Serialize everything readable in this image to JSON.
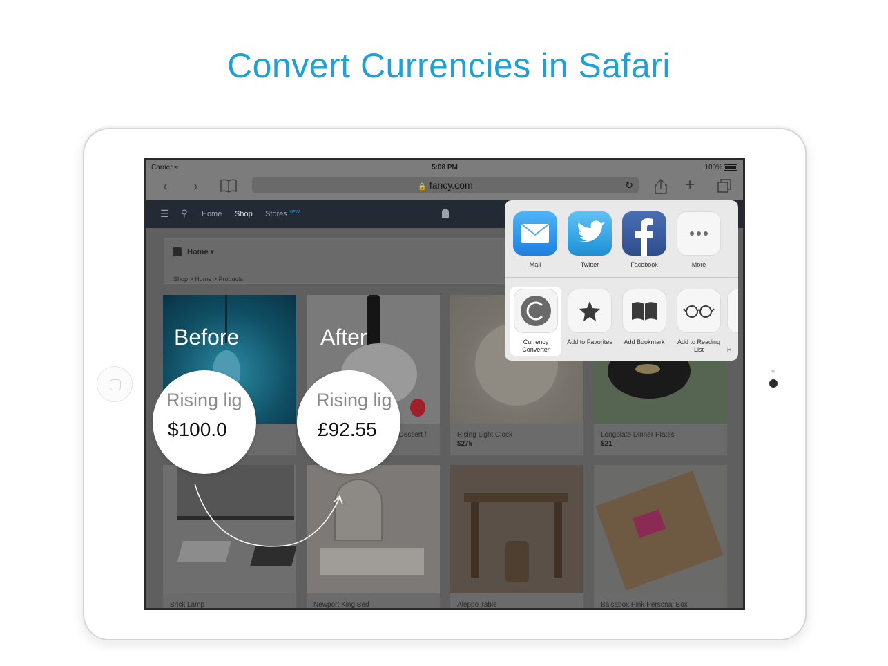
{
  "headline": "Convert Currencies in Safari",
  "status": {
    "carrier": "Carrier",
    "time": "5:08 PM",
    "battery": "100%"
  },
  "browser": {
    "url": "fancy.com"
  },
  "site_nav": {
    "home": "Home",
    "shop": "Shop",
    "stores": "Stores",
    "stores_badge": "NEW"
  },
  "breadcrumb": {
    "title": "Home",
    "path": "Shop  >  Home  >  Products"
  },
  "products": [
    {
      "title": "Rising Light Clock",
      "price": "$275"
    },
    {
      "title": "Longplate Dinner Plates",
      "price": "$21"
    },
    {
      "title": "t Dessert f",
      "price": ""
    },
    {
      "title": "Brick Lamp",
      "price": ""
    },
    {
      "title": "Newport King Bed",
      "price": ""
    },
    {
      "title": "Aleppo Table",
      "price": ""
    },
    {
      "title": "Balsabox Pink Personal Box",
      "price": ""
    }
  ],
  "overlay": {
    "before": "Before",
    "after": "After",
    "before_bubble": {
      "label": "Rising lig",
      "price": "$100.0"
    },
    "after_bubble": {
      "label": "Rising lig",
      "price": "£92.55"
    }
  },
  "share_sheet": {
    "row1": [
      {
        "label": "Mail",
        "icon": "mail-icon"
      },
      {
        "label": "Twitter",
        "icon": "twitter-icon"
      },
      {
        "label": "Facebook",
        "icon": "facebook-icon"
      },
      {
        "label": "More",
        "icon": "more-icon"
      }
    ],
    "row2": [
      {
        "label": "Currency Converter",
        "icon": "currency-converter-icon"
      },
      {
        "label": "Add to Favorites",
        "icon": "star-icon"
      },
      {
        "label": "Add Bookmark",
        "icon": "book-icon"
      },
      {
        "label": "Add to Reading List",
        "icon": "glasses-icon"
      },
      {
        "label": "H",
        "icon": "partial-icon"
      }
    ]
  },
  "colors": {
    "headline": "#1fa0d8",
    "facebook": "#3b5998",
    "twitter": "#1da1f2",
    "mail": "#2b8fe6"
  }
}
